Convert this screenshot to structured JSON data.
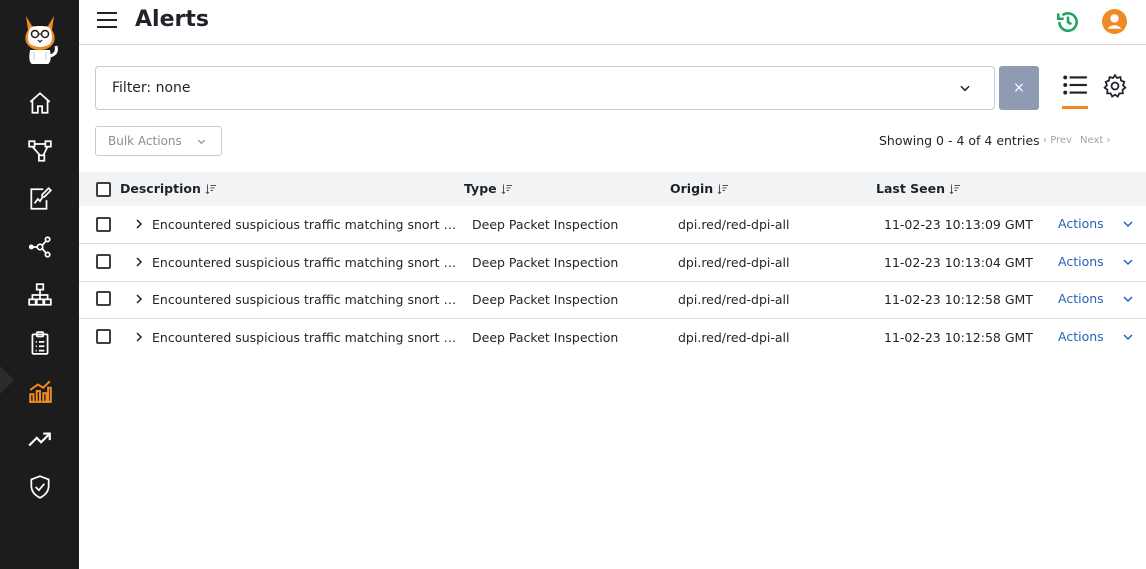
{
  "header": {
    "title": "Alerts"
  },
  "sidebar": {
    "items": [
      {
        "icon": "home-icon"
      },
      {
        "icon": "topology-icon"
      },
      {
        "icon": "report-edit-icon"
      },
      {
        "icon": "network-nodes-icon"
      },
      {
        "icon": "sitemap-icon"
      },
      {
        "icon": "clipboard-icon"
      },
      {
        "icon": "bar-chart-icon",
        "active": true
      },
      {
        "icon": "trending-up-icon"
      },
      {
        "icon": "shield-check-icon"
      }
    ]
  },
  "filter": {
    "label": "Filter: none",
    "clear_label": "×"
  },
  "toolbar": {
    "bulk_actions_label": "Bulk Actions",
    "showing_text": "Showing 0 - 4 of 4 entries",
    "prev_label": "Prev",
    "next_label": "Next"
  },
  "table": {
    "columns": [
      "Description",
      "Type",
      "Origin",
      "Last Seen"
    ],
    "rows": [
      {
        "description": "Encountered suspicious traffic matching snort ru...",
        "type": "Deep Packet Inspection",
        "origin": "dpi.red/red-dpi-all",
        "last_seen": "11-02-23 10:13:09 GMT",
        "actions": "Actions"
      },
      {
        "description": "Encountered suspicious traffic matching snort ru...",
        "type": "Deep Packet Inspection",
        "origin": "dpi.red/red-dpi-all",
        "last_seen": "11-02-23 10:13:04 GMT",
        "actions": "Actions"
      },
      {
        "description": "Encountered suspicious traffic matching snort ru...",
        "type": "Deep Packet Inspection",
        "origin": "dpi.red/red-dpi-all",
        "last_seen": "11-02-23 10:12:58 GMT",
        "actions": "Actions"
      },
      {
        "description": "Encountered suspicious traffic matching snort ru...",
        "type": "Deep Packet Inspection",
        "origin": "dpi.red/red-dpi-all",
        "last_seen": "11-02-23 10:12:58 GMT",
        "actions": "Actions"
      }
    ]
  },
  "colors": {
    "accent": "#f08a24",
    "link": "#2563b8",
    "history": "#1fa463",
    "sidebar": "#1c1c1c"
  }
}
